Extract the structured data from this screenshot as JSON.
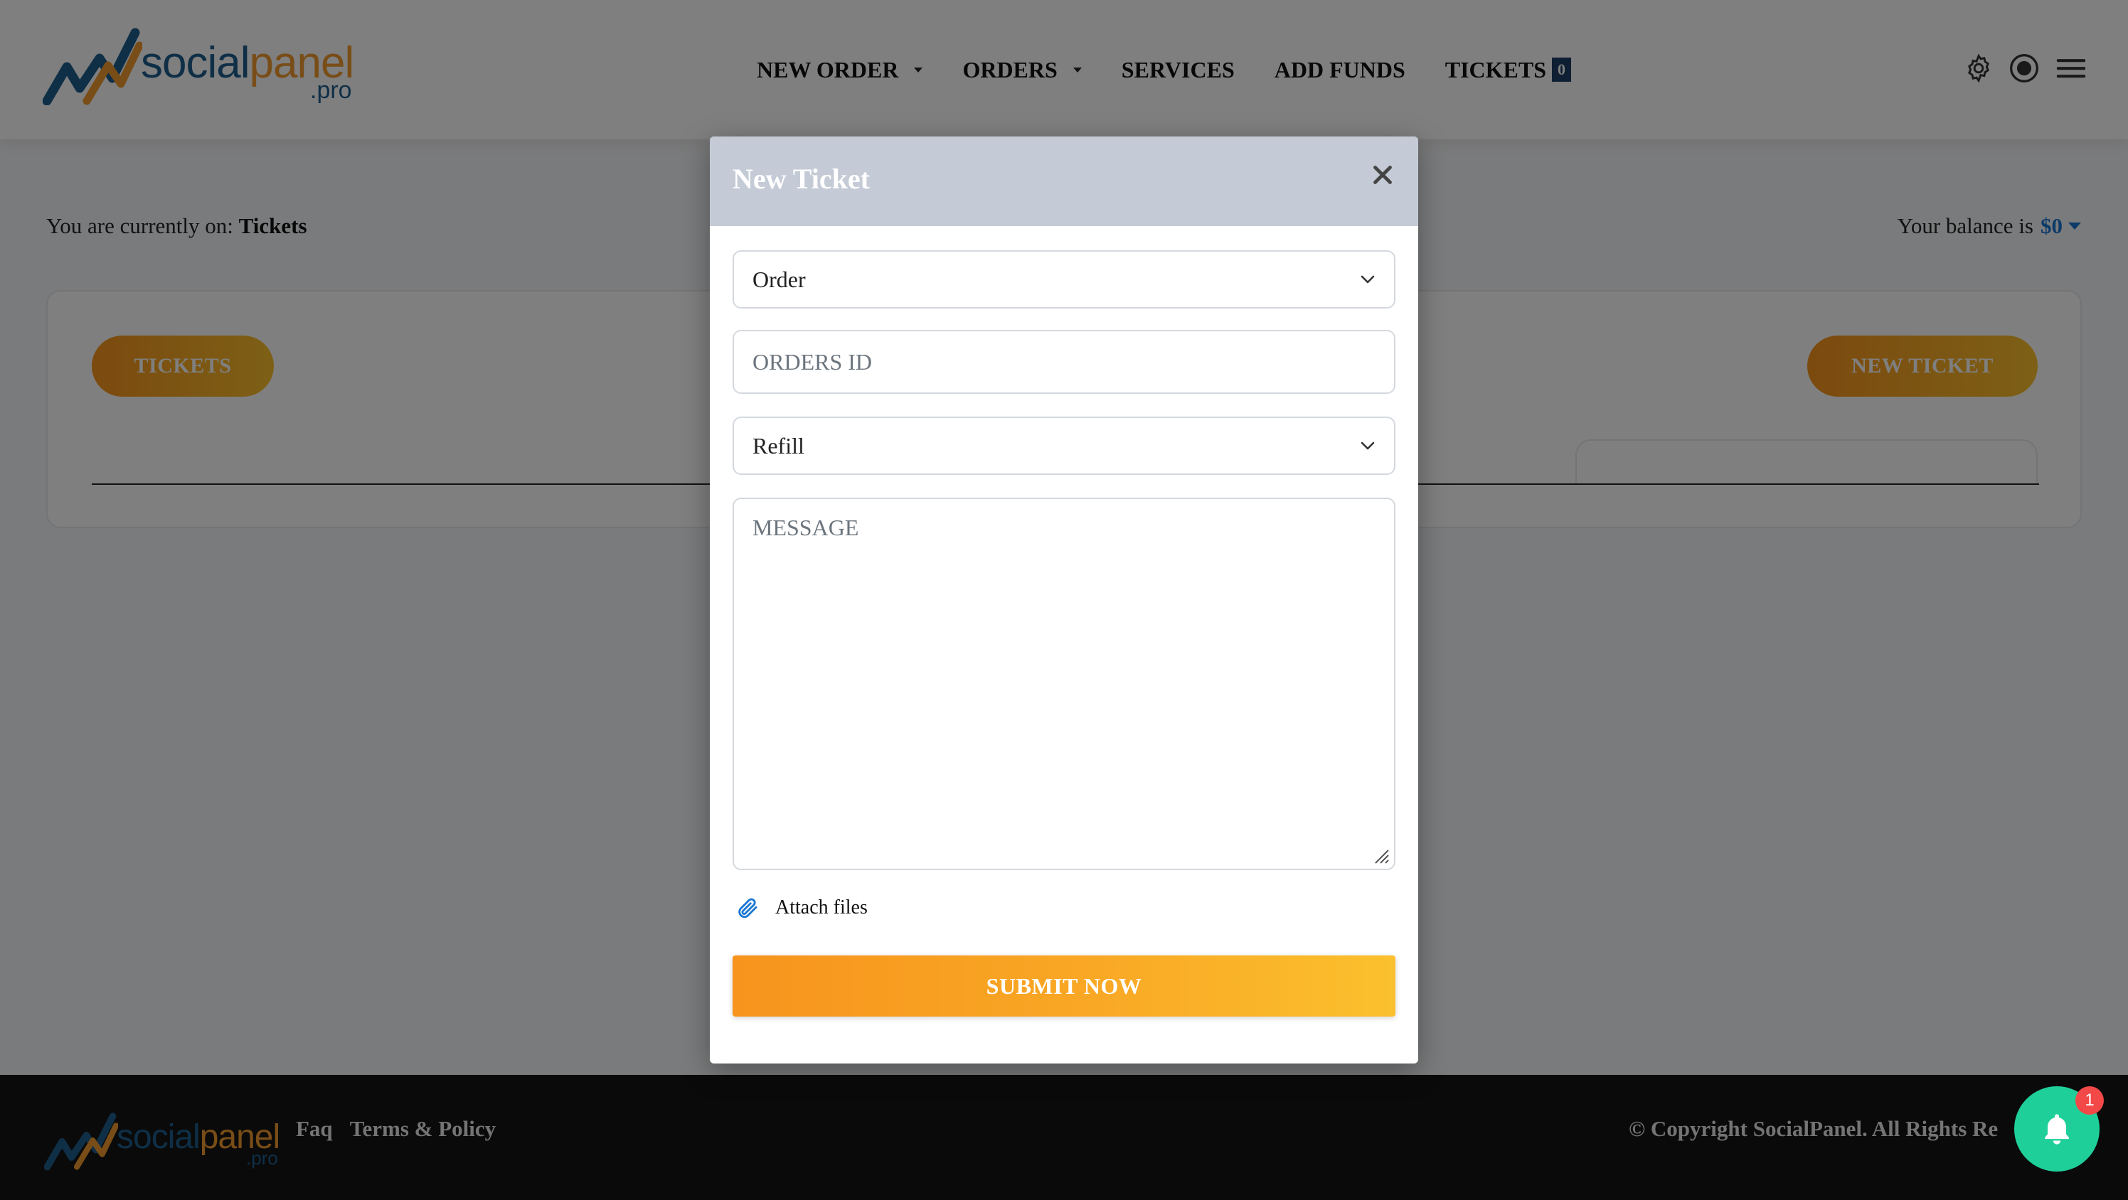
{
  "header": {
    "logo": {
      "word_a": "social",
      "word_b": "panel",
      "sub": ".pro"
    },
    "nav": [
      {
        "label": "NEW ORDER",
        "has_caret": true
      },
      {
        "label": "ORDERS",
        "has_caret": true
      },
      {
        "label": "SERVICES",
        "has_caret": false
      },
      {
        "label": "ADD FUNDS",
        "has_caret": false
      },
      {
        "label": "TICKETS",
        "badge": "0"
      }
    ],
    "icons": [
      "gear-icon",
      "record-icon",
      "hamburger-menu-icon"
    ]
  },
  "page": {
    "crumb_prefix": "You are currently on:",
    "crumb_current": "Tickets",
    "balance_prefix": "Your balance is",
    "balance_value": "$0",
    "tickets_button": "TICKETS",
    "new_ticket_button": "NEW TICKET"
  },
  "modal": {
    "title": "New Ticket",
    "subject_select": {
      "value": "Order",
      "icon": "chevron-down-icon"
    },
    "order_id_input": {
      "placeholder": "ORDERS ID",
      "value": ""
    },
    "request_select": {
      "value": "Refill",
      "icon": "chevron-down-icon"
    },
    "message_textarea": {
      "placeholder": "MESSAGE",
      "value": ""
    },
    "attach_label": "Attach files",
    "submit_label": "SUBMIT NOW"
  },
  "footer": {
    "logo": {
      "word_a": "social",
      "word_b": "panel",
      "sub": ".pro"
    },
    "links": [
      "Faq",
      "Terms & Policy"
    ],
    "copyright": "© Copyright SocialPanel. All Rights Re"
  },
  "notification": {
    "count": "1"
  },
  "colors": {
    "accent_start": "#f7941d",
    "accent_end": "#fbc02d",
    "brand_blue": "#1f5f8f",
    "logo_orange": "#f29a2e",
    "balance_blue": "#1976d2",
    "badge_navy": "#1d3d66",
    "modal_header": "#c4cbd6",
    "notification_green": "#1fcf9a",
    "notification_red": "#f24848",
    "footer_bg": "#151515"
  }
}
